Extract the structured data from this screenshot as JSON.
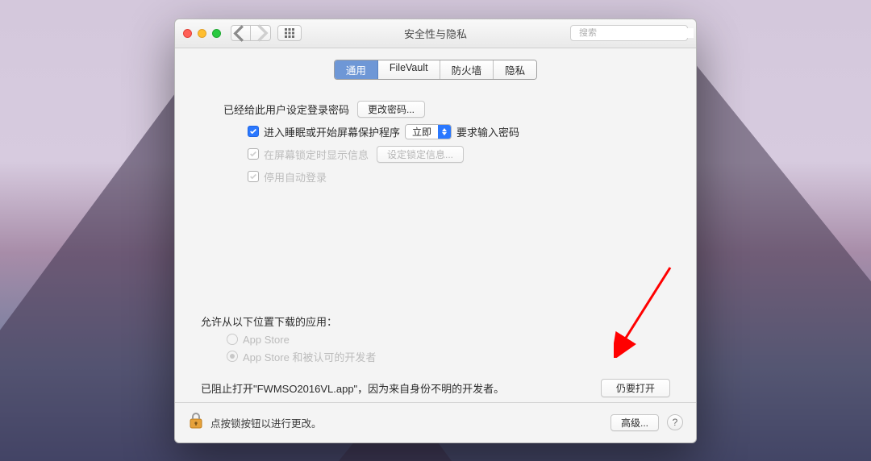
{
  "window": {
    "title": "安全性与隐私"
  },
  "search": {
    "placeholder": "搜索"
  },
  "tabs": {
    "general": "通用",
    "filevault": "FileVault",
    "firewall": "防火墙",
    "privacy": "隐私"
  },
  "section1": {
    "password_set": "已经给此用户设定登录密码",
    "change_password": "更改密码...",
    "require_password_prefix": "进入睡眠或开始屏幕保护程序",
    "require_password_select": "立即",
    "require_password_suffix": "要求输入密码",
    "lockscreen_msg": "在屏幕锁定时显示信息",
    "set_lock_info": "设定锁定信息...",
    "disable_autologin": "停用自动登录"
  },
  "section2": {
    "allow_title": "允许从以下位置下载的应用：",
    "opt_appstore": "App Store",
    "opt_identified": "App Store 和被认可的开发者",
    "blocked_msg": "已阻止打开\"FWMSO2016VL.app\"，因为来自身份不明的开发者。",
    "open_anyway": "仍要打开"
  },
  "footer": {
    "lock_msg": "点按锁按钮以进行更改。",
    "advanced": "高级..."
  },
  "colors": {
    "accent": "#2a78ff",
    "annotation": "#ff0000"
  }
}
